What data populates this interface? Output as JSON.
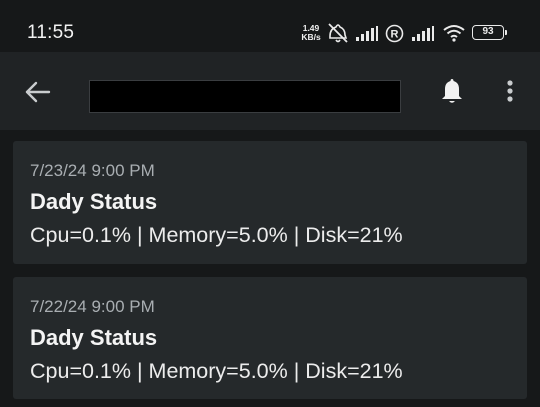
{
  "status_bar": {
    "time": "11:55",
    "net_speed_value": "1.49",
    "net_speed_unit": "KB/s",
    "battery_level": "93",
    "icons": [
      "mute-alarm-icon",
      "signal-bars-icon",
      "roaming-icon",
      "signal-bars-icon",
      "wifi-icon",
      "battery-icon"
    ]
  },
  "app_bar": {
    "icons": [
      "back-arrow-icon",
      "bell-icon",
      "more-vertical-icon"
    ]
  },
  "notifications": [
    {
      "date": "7/23/24 9:00 PM",
      "title": "Dady Status",
      "body": "Cpu=0.1% | Memory=5.0% | Disk=21%"
    },
    {
      "date": "7/22/24 9:00 PM",
      "title": "Dady Status",
      "body": "Cpu=0.1% | Memory=5.0% | Disk=21%"
    }
  ],
  "colors": {
    "background": "#161819",
    "app_bar": "#202325",
    "card": "#25292b",
    "date_text": "#a9aeb2"
  }
}
